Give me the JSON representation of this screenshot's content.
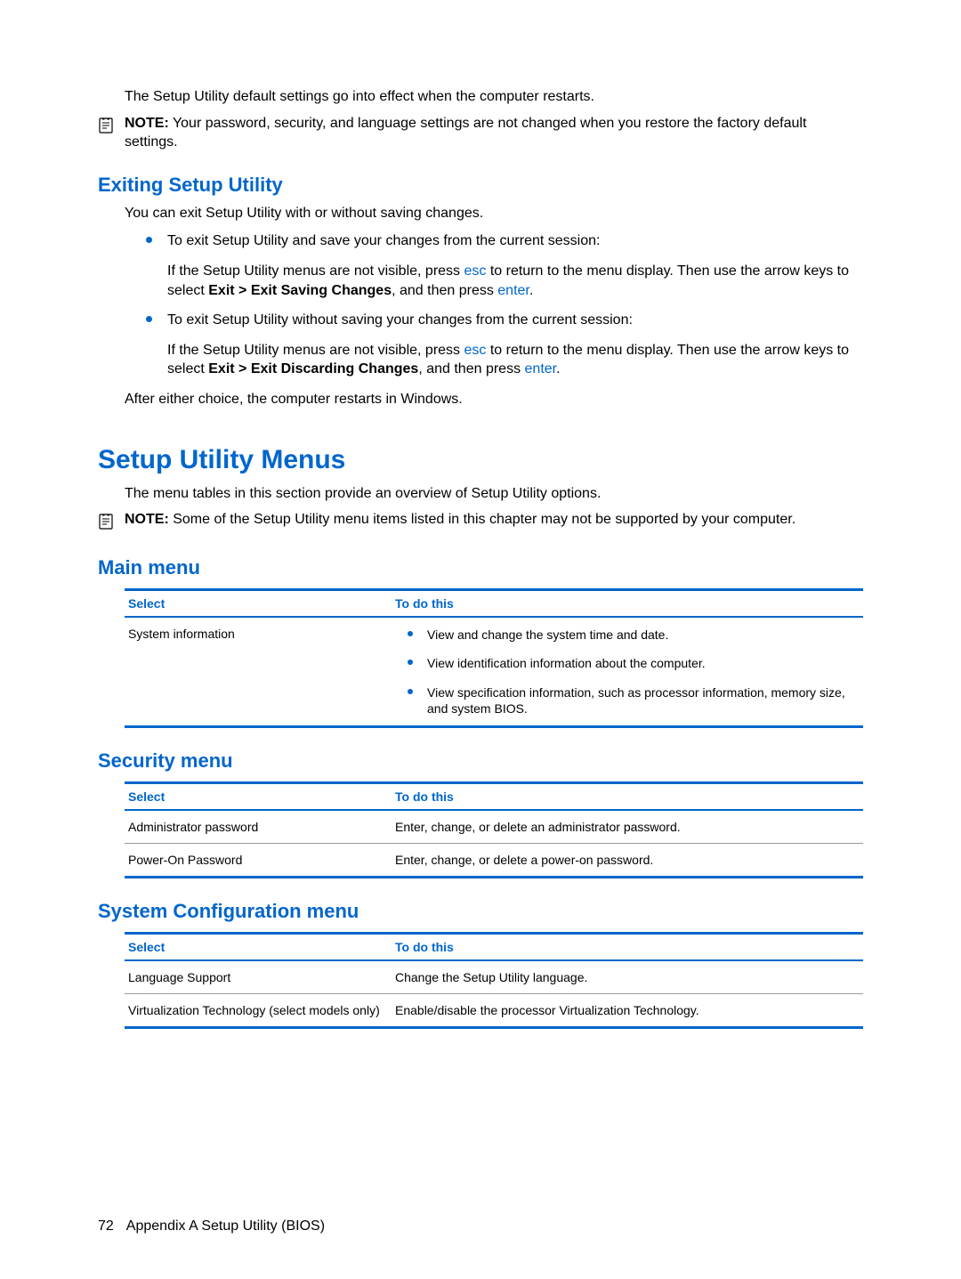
{
  "intro": {
    "restart_text": "The Setup Utility default settings go into effect when the computer restarts.",
    "note_label": "NOTE:",
    "note_text": "Your password, security, and language settings are not changed when you restore the factory default settings."
  },
  "exiting": {
    "heading": "Exiting Setup Utility",
    "intro": "You can exit Setup Utility with or without saving changes.",
    "bullet1": "To exit Setup Utility and save your changes from the current session:",
    "bullet1_detail_a": "If the Setup Utility menus are not visible, press ",
    "esc": "esc",
    "bullet1_detail_b": " to return to the menu display. Then use the arrow keys to select ",
    "bullet1_bold": "Exit > Exit Saving Changes",
    "bullet1_detail_c": ", and then press ",
    "enter": "enter",
    "period": ".",
    "bullet2": "To exit Setup Utility without saving your changes from the current session:",
    "bullet2_detail_a": "If the Setup Utility menus are not visible, press ",
    "bullet2_detail_b": " to return to the menu display. Then use the arrow keys to select ",
    "bullet2_bold": "Exit > Exit Discarding Changes",
    "bullet2_detail_c": ", and then press ",
    "after": "After either choice, the computer restarts in Windows."
  },
  "menus": {
    "heading": "Setup Utility Menus",
    "intro": "The menu tables in this section provide an overview of Setup Utility options.",
    "note_label": "NOTE:",
    "note_text": "Some of the Setup Utility menu items listed in this chapter may not be supported by your computer."
  },
  "table_headers": {
    "select": "Select",
    "todo": "To do this"
  },
  "main_menu": {
    "heading": "Main menu",
    "row1_select": "System information",
    "row1_items": [
      "View and change the system time and date.",
      "View identification information about the computer.",
      "View specification information, such as processor information, memory size, and system BIOS."
    ]
  },
  "security_menu": {
    "heading": "Security menu",
    "rows": [
      {
        "select": "Administrator password",
        "todo": "Enter, change, or delete an administrator password."
      },
      {
        "select": "Power-On Password",
        "todo": "Enter, change, or delete a power-on password."
      }
    ]
  },
  "sysconfig_menu": {
    "heading": "System Configuration menu",
    "rows": [
      {
        "select": "Language Support",
        "todo": "Change the Setup Utility language."
      },
      {
        "select": "Virtualization Technology (select models only)",
        "todo": "Enable/disable the processor Virtualization Technology."
      }
    ]
  },
  "footer": {
    "page": "72",
    "title": "Appendix A   Setup Utility (BIOS)"
  }
}
